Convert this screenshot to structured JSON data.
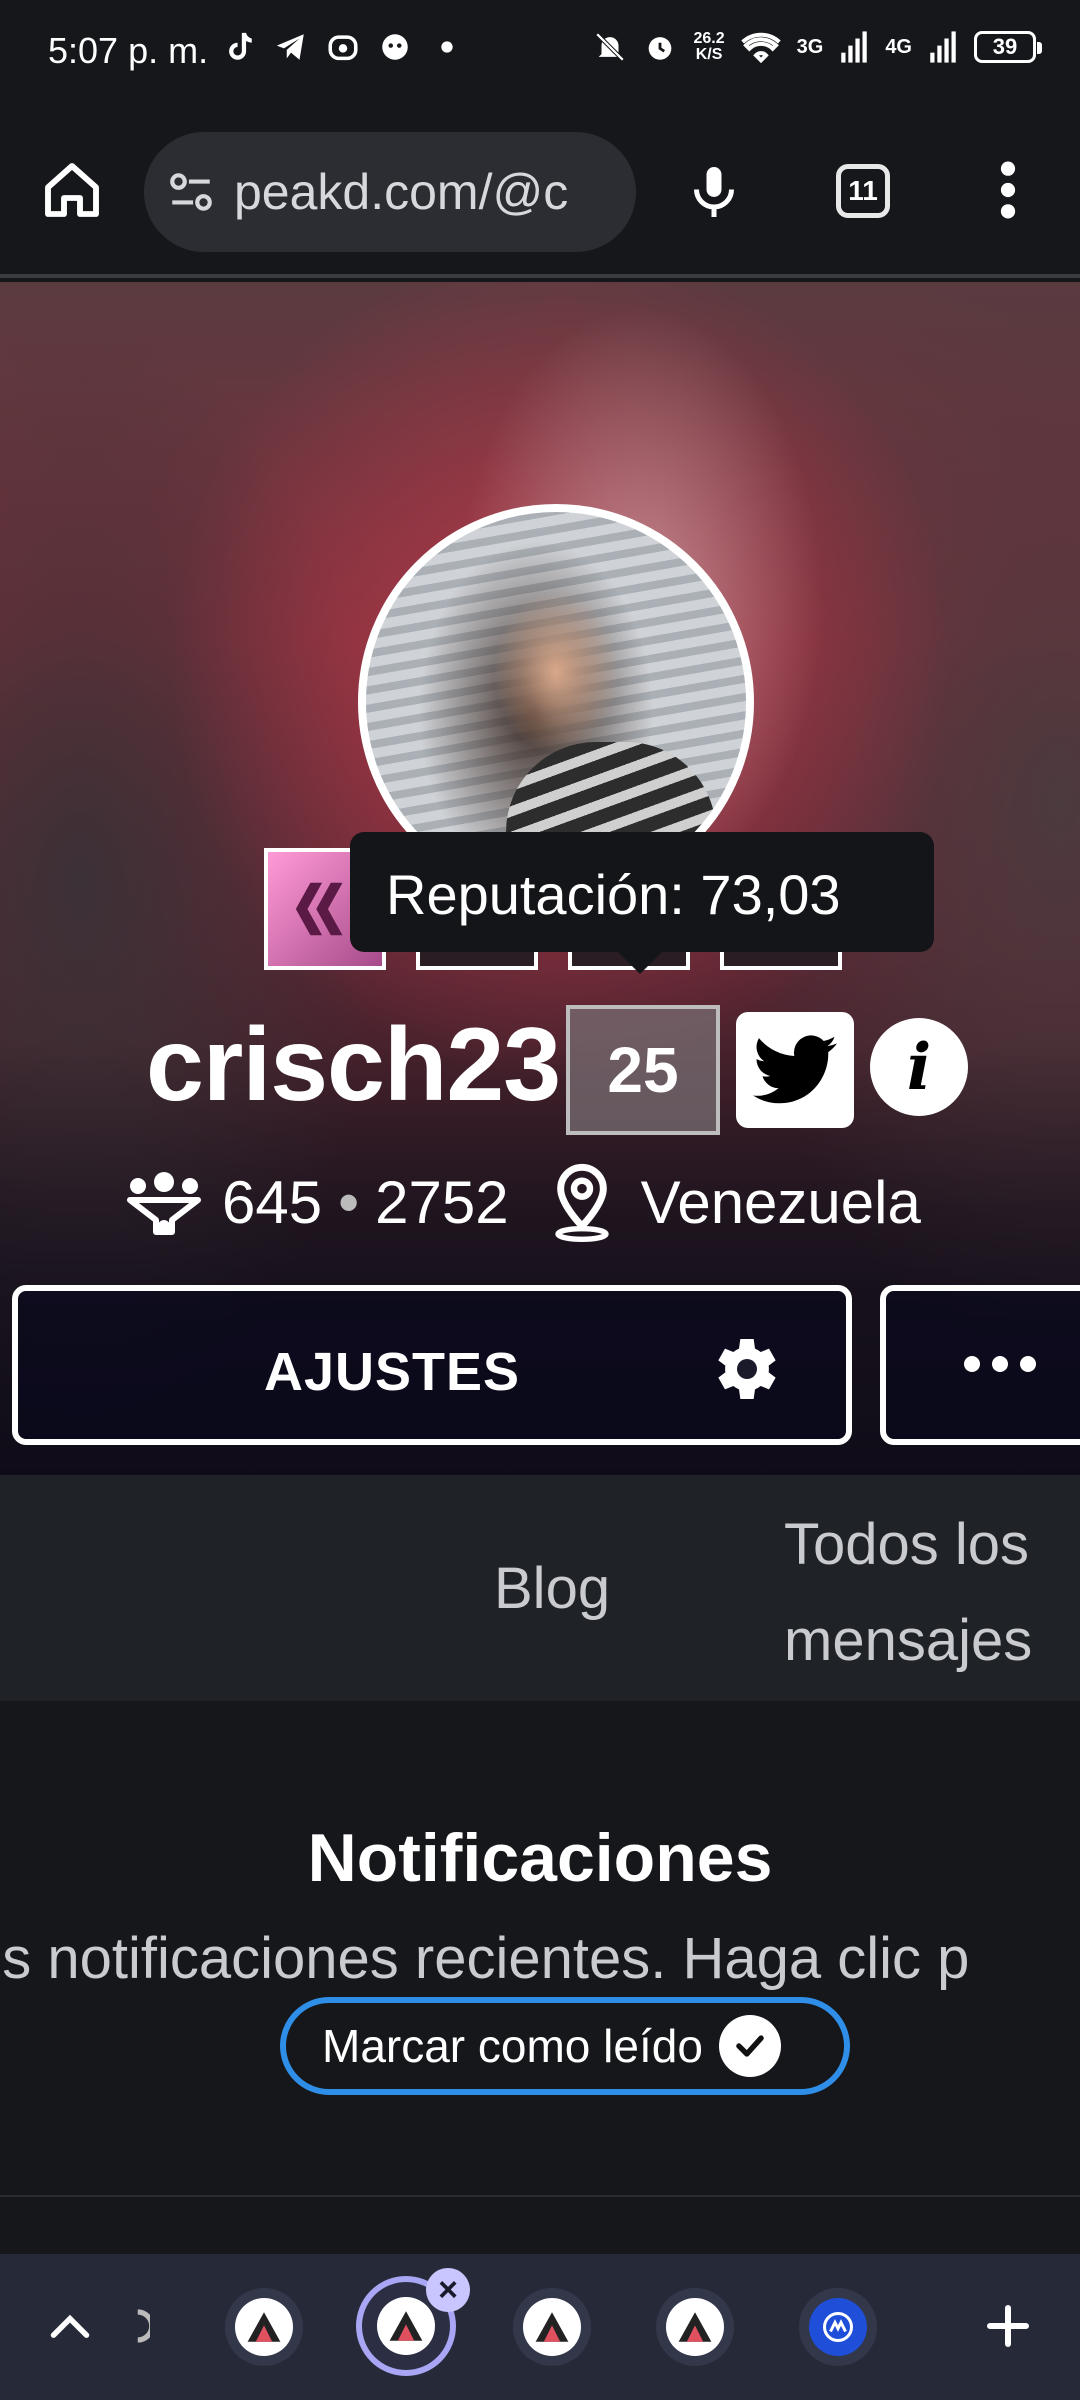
{
  "status_bar": {
    "time": "5:07 p. m.",
    "net_speed_value": "26.2",
    "net_speed_unit": "K/S",
    "signal_1": "3G",
    "signal_2": "4G",
    "battery": "39"
  },
  "browser": {
    "url": "peakd.com/@c",
    "tab_count": "11"
  },
  "profile": {
    "tooltip": "Reputación: 73,03",
    "username": "crisch23",
    "reputation": "25",
    "followers": "645",
    "following": "2752",
    "location": "Venezuela",
    "settings_button": "AJUSTES"
  },
  "tabs": {
    "blog": "Blog",
    "all_posts_line1": "Todos los",
    "all_posts_line2": "mensajes"
  },
  "notifications": {
    "title": "Notificaciones",
    "description": "us notificaciones recientes. Haga clic p",
    "mark_read": "Marcar como leído"
  },
  "colors": {
    "background": "#15171b",
    "accent_blue": "#2f8fe8",
    "selected_tab_ring": "#a9a6f5"
  },
  "icons": [
    "home-icon",
    "tune-icon",
    "mic-icon",
    "more-vert-icon",
    "gear-icon",
    "twitter-icon",
    "info-icon",
    "followers-icon",
    "location-pin-icon",
    "check-icon",
    "chevron-up-icon",
    "plus-icon",
    "close-icon",
    "peakd-icon"
  ]
}
